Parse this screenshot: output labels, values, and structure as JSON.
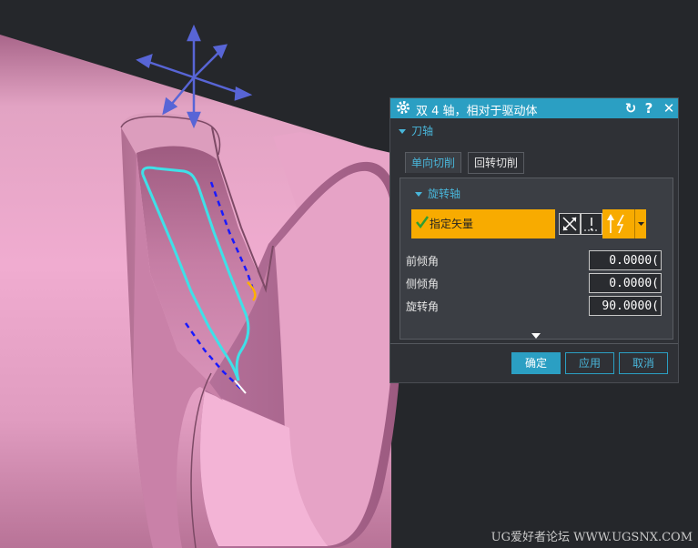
{
  "dialog": {
    "title": "双 4 轴，相对于驱动体",
    "icons": [
      "gear-icon",
      "reset-icon",
      "help-icon",
      "close-icon"
    ],
    "help_label": "?",
    "close_label": "✕",
    "section_label": "刀轴",
    "tabs": [
      {
        "label": "单向切削",
        "active": true
      },
      {
        "label": "回转切削",
        "active": false
      }
    ],
    "rotation_axis_label": "旋转轴",
    "specify_vector_label": "指定矢量",
    "vector_icons": [
      "vector-dialog-icon",
      "reverse-direction-icon",
      "vector-type-icon"
    ],
    "fields": [
      {
        "label": "前倾角",
        "value": "0.0000("
      },
      {
        "label": "侧倾角",
        "value": "0.0000("
      },
      {
        "label": "旋转角",
        "value": "90.0000("
      }
    ],
    "buttons": {
      "ok": "确定",
      "apply": "应用",
      "cancel": "取消"
    }
  },
  "watermark": "UG爱好者论坛 WWW.UGSNX.COM",
  "colors": {
    "accent": "#2b9fc3",
    "highlight": "#f8ab00",
    "background": "#25272b",
    "part": "#d98eb5",
    "toolpath": "#3fe0e8",
    "move_path": "#1a1aff",
    "triad": "#5865d6"
  }
}
